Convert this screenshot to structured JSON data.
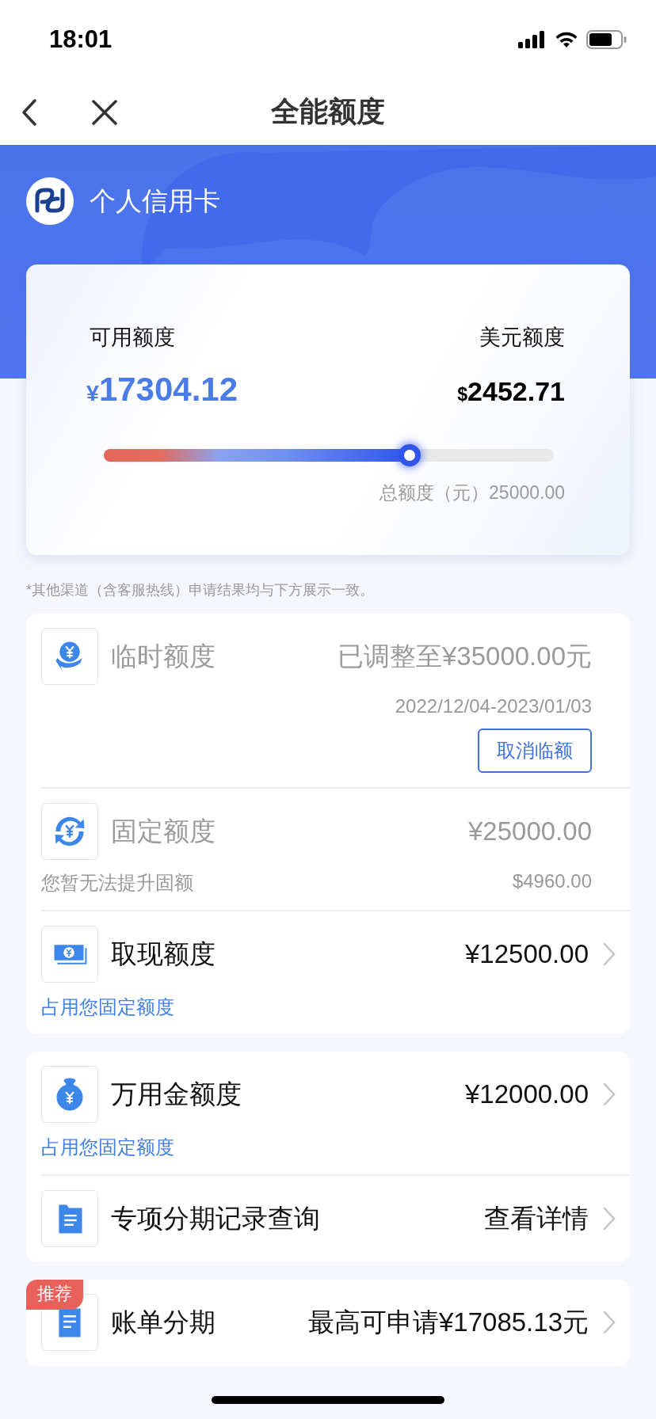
{
  "status_bar": {
    "time": "18:01"
  },
  "nav": {
    "title": "全能额度"
  },
  "header": {
    "title": "个人信用卡"
  },
  "summary": {
    "available_label": "可用额度",
    "available_currency": "¥",
    "available_amount": "17304.12",
    "usd_label": "美元额度",
    "usd_currency": "$",
    "usd_amount": "2452.71",
    "level": 0.68,
    "total": "总额度（元）25000.00"
  },
  "note": "*其他渠道（含客服热线）申请结果均与下方展示一致。",
  "groups": [
    {
      "items": [
        {
          "kind": "hand-coin",
          "title": "临时额度",
          "value": "已调整至¥35000.00元",
          "muted": true,
          "arrow": false,
          "date": "2022/12/04-2023/01/03",
          "button": "取消临额"
        },
        {
          "kind": "exchange",
          "title": "固定额度",
          "value": "¥25000.00",
          "muted": true,
          "arrow": false,
          "sub_left": "您暂无法提升固额",
          "sub_right": "$4960.00"
        },
        {
          "kind": "banknote",
          "title": "取现额度",
          "value": "¥12500.00",
          "muted": false,
          "arrow": true,
          "sub_link": "占用您固定额度"
        }
      ]
    },
    {
      "items": [
        {
          "kind": "money-bag",
          "title": "万用金额度",
          "value": "¥12000.00",
          "muted": false,
          "arrow": true,
          "sub_link": "占用您固定额度"
        },
        {
          "kind": "document",
          "title": "专项分期记录查询",
          "value": "查看详情",
          "muted": false,
          "arrow": true
        }
      ]
    },
    {
      "tag": "推荐",
      "items": [
        {
          "kind": "bill",
          "title": "账单分期",
          "value": "最高可申请¥17085.13元",
          "muted": false,
          "arrow": true
        }
      ]
    }
  ]
}
